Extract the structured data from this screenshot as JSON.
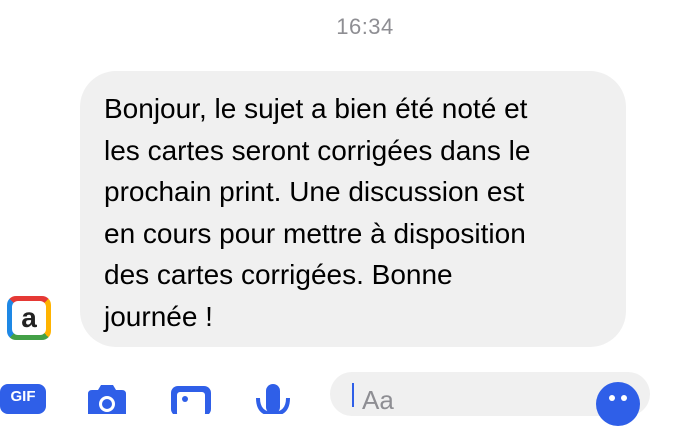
{
  "conversation": {
    "timestamp": "16:34",
    "message": {
      "text": "Bonjour, le sujet a bien été noté et\nles cartes seront corrigées dans le\nprochain print. Une discussion est\nen cours pour mettre à disposition\ndes cartes corrigées. Bonne\njournée !"
    },
    "sender_avatar_letter": "a"
  },
  "composer": {
    "gif_label": "GIF",
    "input_text": "Aa",
    "icons": [
      "gif-icon",
      "camera-icon",
      "image-icon",
      "microphone-icon",
      "emoji-icon"
    ]
  },
  "colors": {
    "accent": "#2f5fe8",
    "bubble": "#f0f0f0",
    "timestamp": "#8e8e93"
  }
}
